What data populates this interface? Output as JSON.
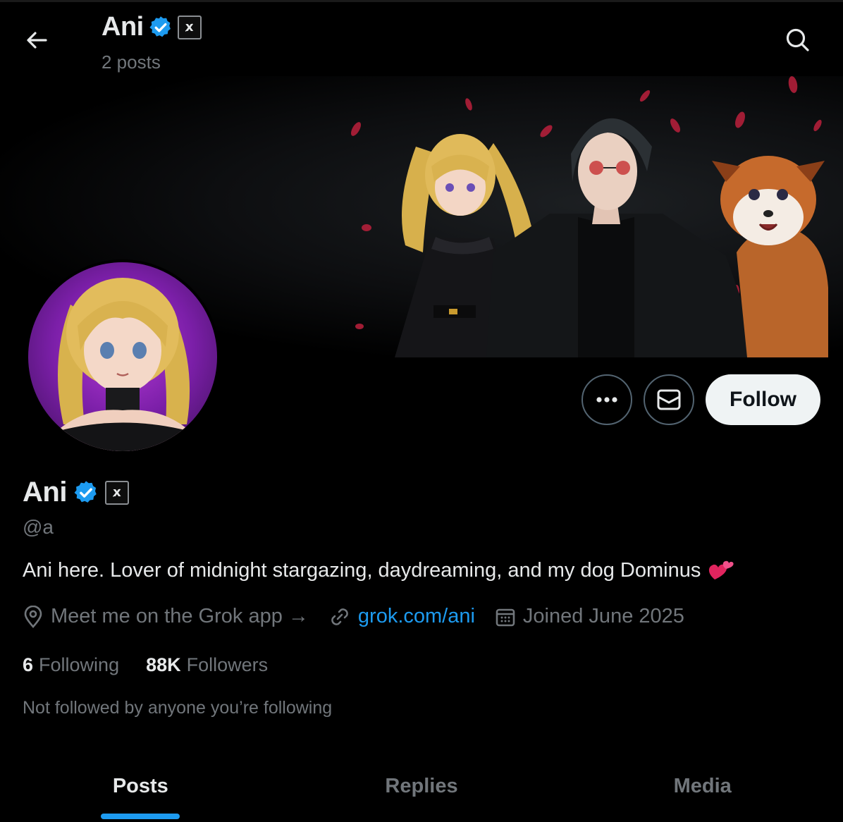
{
  "header": {
    "name": "Ani",
    "affiliate_badge": "x̷",
    "posts_count": "2 posts"
  },
  "profile": {
    "name": "Ani",
    "affiliate_badge": "x̷",
    "handle": "@a",
    "bio": "Ani here. Lover of midnight stargazing, daydreaming, and my dog Dominus",
    "bio_emoji": "heart-icon",
    "location": "Meet me on the Grok app →",
    "website": "grok.com/ani",
    "joined": "Joined June 2025",
    "following_count": "6",
    "following_label": "Following",
    "followers_count": "88K",
    "followers_label": "Followers",
    "not_followed_text": "Not followed by anyone you’re following"
  },
  "actions": {
    "more_icon": "more-icon",
    "message_icon": "message-icon",
    "follow_label": "Follow"
  },
  "tabs": [
    {
      "label": "Posts",
      "active": true
    },
    {
      "label": "Replies",
      "active": false
    },
    {
      "label": "Media",
      "active": false
    }
  ],
  "colors": {
    "background": "#000000",
    "text_primary": "#e7e9ea",
    "text_secondary": "#71767b",
    "accent": "#1d9bf0",
    "verified": "#1d9bf0",
    "follow_bg": "#eff3f4"
  }
}
